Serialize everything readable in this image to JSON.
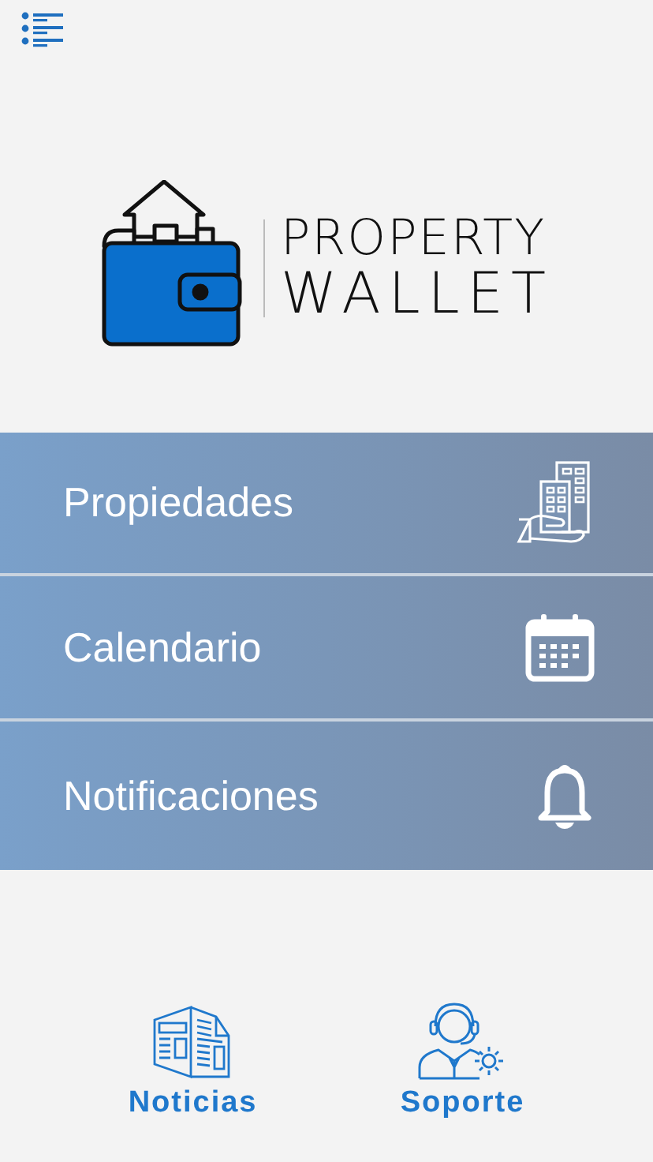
{
  "logo": {
    "line_1": "PROPERTY",
    "line_2": "WALLET"
  },
  "menu": [
    {
      "label": "Propiedades",
      "kind": "buildings"
    },
    {
      "label": "Calendario",
      "kind": "calendar"
    },
    {
      "label": "Notificaciones",
      "kind": "bell"
    }
  ],
  "bottom_nav": [
    {
      "label": "Noticias",
      "kind": "newspaper"
    },
    {
      "label": "Soporte",
      "kind": "support"
    }
  ]
}
